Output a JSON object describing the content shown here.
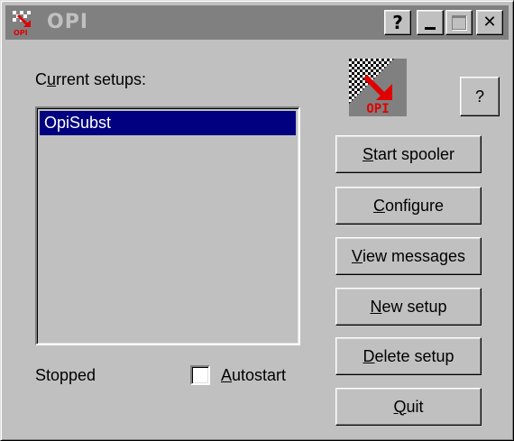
{
  "window": {
    "title": "OPI",
    "buttons": {
      "help": "?",
      "minimize": "_",
      "close": "✕"
    }
  },
  "current_setups_label": {
    "pre": "C",
    "key": "u",
    "post": "rrent setups:"
  },
  "setups": [
    {
      "name": "OpiSubst",
      "selected": true
    }
  ],
  "status_text": "Stopped",
  "autostart": {
    "pre": "",
    "key": "A",
    "post": "utostart",
    "checked": false
  },
  "help_button": "?",
  "logo_text": "OPI",
  "buttons": [
    {
      "id": "start-spooler",
      "key": "S",
      "rest": "tart spooler",
      "pre": ""
    },
    {
      "id": "configure",
      "key": "C",
      "rest": "onfigure",
      "pre": ""
    },
    {
      "id": "view-messages",
      "key": "V",
      "rest": "iew messages",
      "pre": ""
    },
    {
      "id": "new-setup",
      "key": "N",
      "rest": "ew setup",
      "pre": ""
    },
    {
      "id": "delete-setup",
      "key": "D",
      "rest": "elete setup",
      "pre": ""
    },
    {
      "id": "quit",
      "key": "Q",
      "rest": "uit",
      "pre": ""
    }
  ],
  "colors": {
    "titlebar_inactive": "#808080",
    "face": "#c0c0c0",
    "selection": "#000080",
    "logo_accent": "#e00000"
  }
}
